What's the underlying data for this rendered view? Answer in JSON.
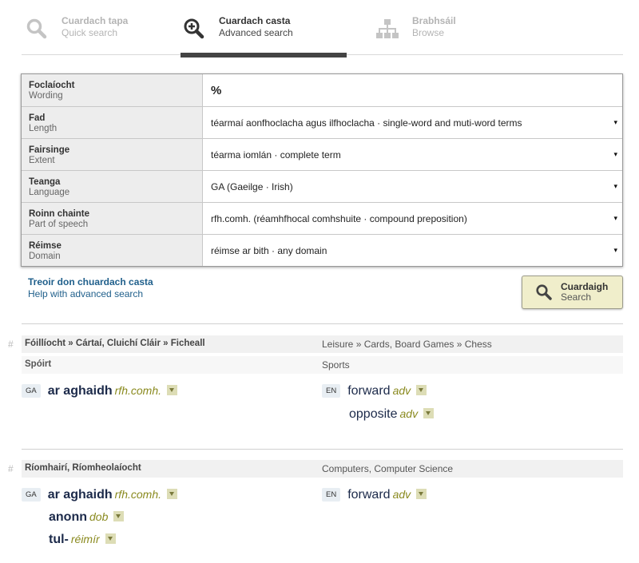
{
  "tabs": [
    {
      "ga": "Cuardach tapa",
      "en": "Quick search"
    },
    {
      "ga": "Cuardach casta",
      "en": "Advanced search"
    },
    {
      "ga": "Brabhsáil",
      "en": "Browse"
    }
  ],
  "form": {
    "rows": [
      {
        "label_ga": "Foclaíocht",
        "label_en": "Wording",
        "value": "%"
      },
      {
        "label_ga": "Fad",
        "label_en": "Length",
        "value": "téarmaí aonfhoclacha agus ilfhoclacha · single-word and muti-word terms"
      },
      {
        "label_ga": "Fairsinge",
        "label_en": "Extent",
        "value": "téarma iomlán · complete term"
      },
      {
        "label_ga": "Teanga",
        "label_en": "Language",
        "value": "GA (Gaeilge · Irish)"
      },
      {
        "label_ga": "Roinn chainte",
        "label_en": "Part of speech",
        "value": "rfh.comh. (réamhfhocal comhshuite · compound preposition)"
      },
      {
        "label_ga": "Réimse",
        "label_en": "Domain",
        "value": "réimse ar bith · any domain"
      }
    ],
    "caret": "▾"
  },
  "help": {
    "ga": "Treoir don chuardach casta",
    "en": "Help with advanced search"
  },
  "search_button": {
    "ga": "Cuardaigh",
    "en": "Search"
  },
  "results": [
    {
      "hash": "#",
      "domain_ga": "Fóillíocht » Cártaí, Cluichí Cláir » Ficheall",
      "domain_en": "Leisure » Cards, Board Games » Chess",
      "subdomain_ga": "Spóirt",
      "subdomain_en": "Sports",
      "ga_terms": [
        {
          "lang": "GA",
          "word": "ar aghaidh",
          "pos": "rfh.comh."
        }
      ],
      "en_terms": [
        {
          "lang": "EN",
          "word": "forward",
          "pos": "adv"
        },
        {
          "word": "opposite",
          "pos": "adv"
        }
      ]
    },
    {
      "hash": "#",
      "domain_ga": "Ríomhairí, Ríomheolaíocht",
      "domain_en": "Computers, Computer Science",
      "ga_terms": [
        {
          "lang": "GA",
          "word": "ar aghaidh",
          "pos": "rfh.comh."
        },
        {
          "word": "anonn",
          "pos": "dob"
        },
        {
          "word": "tul-",
          "pos": "réimír"
        }
      ],
      "en_terms": [
        {
          "lang": "EN",
          "word": "forward",
          "pos": "adv"
        }
      ]
    }
  ],
  "colors": {
    "accent_link": "#1f5f8b",
    "pos_olive": "#8a8a1f",
    "active_bar": "#444444",
    "search_bg": "#f0eecb"
  }
}
